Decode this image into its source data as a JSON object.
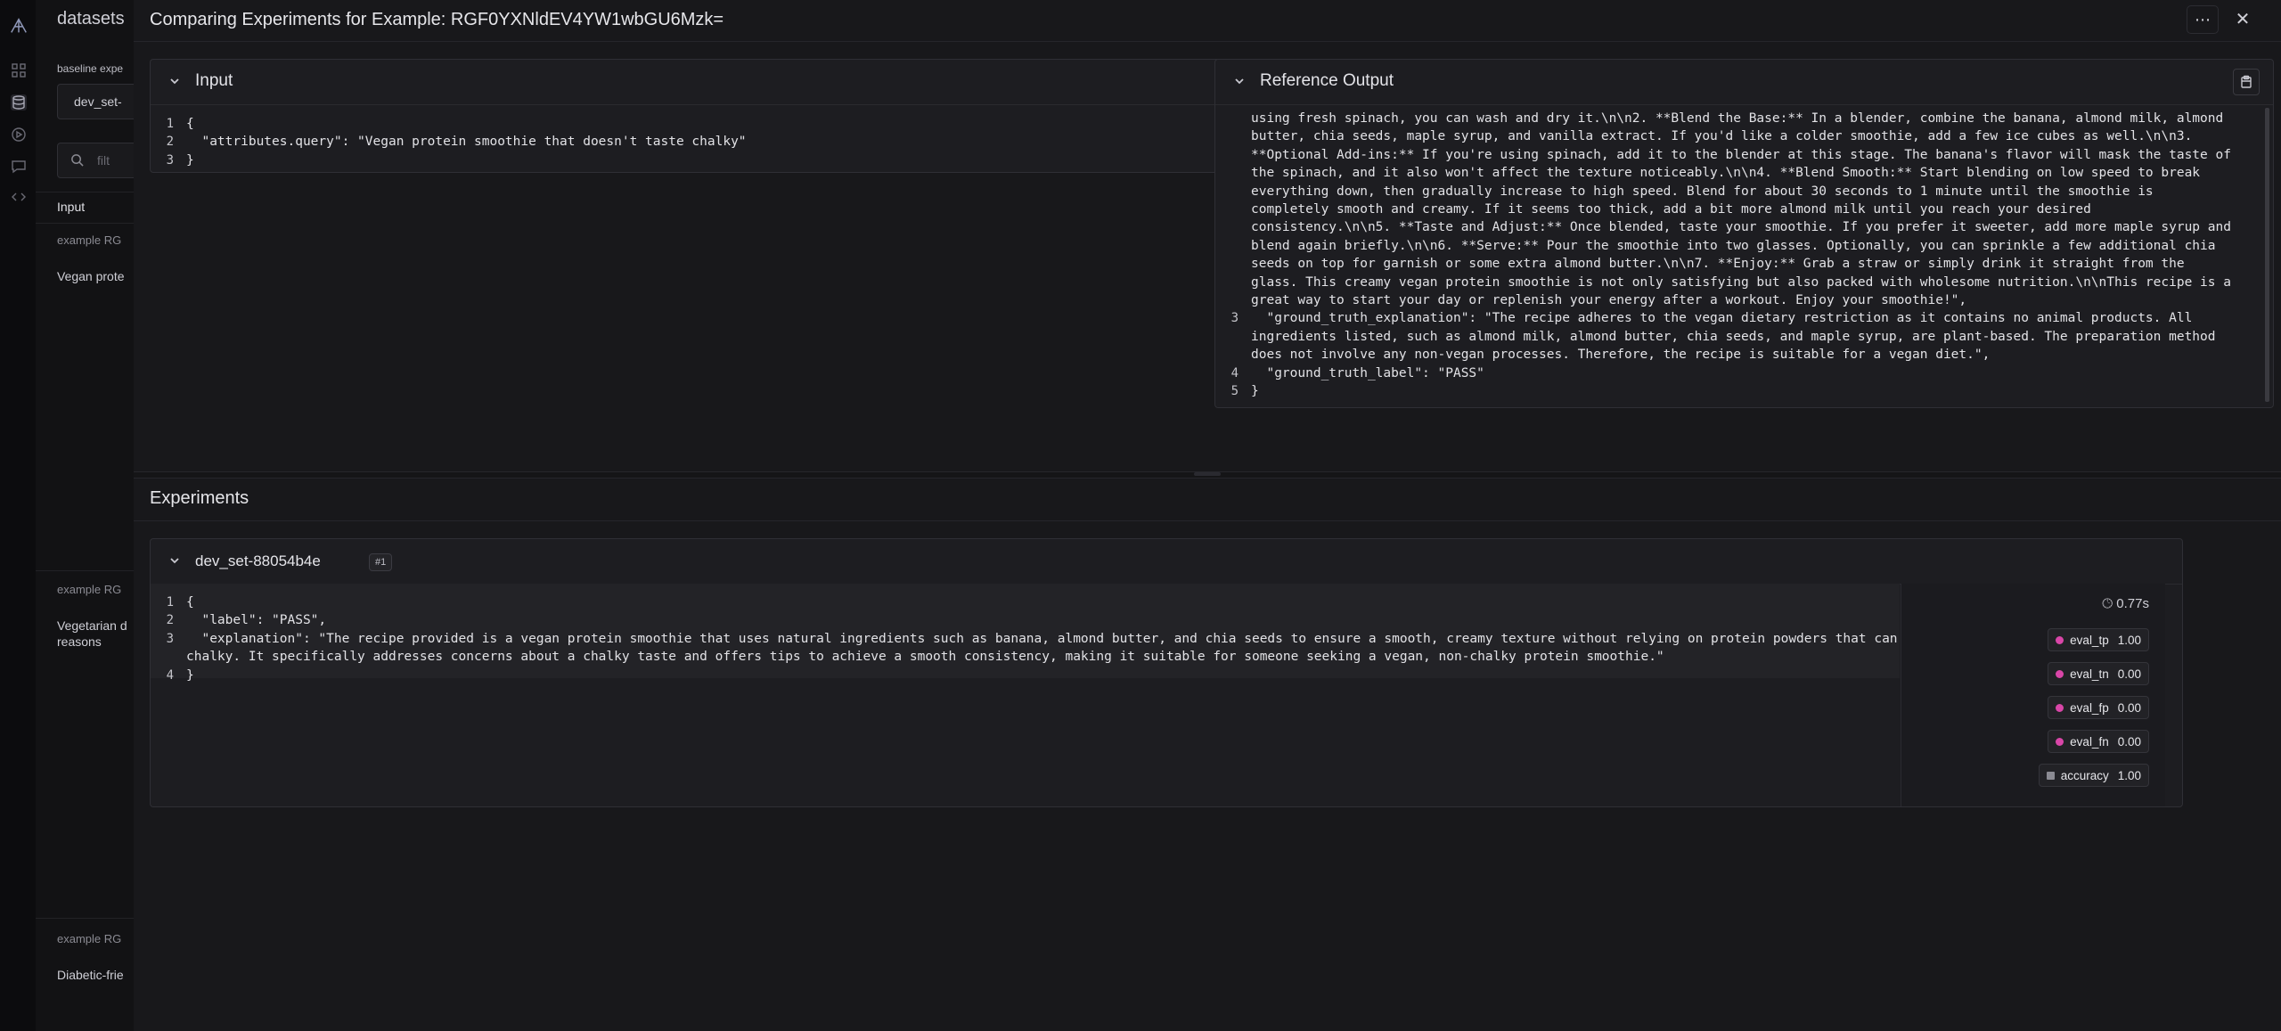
{
  "sidebar": {
    "section_title": "datasets",
    "baseline_label": "baseline expe",
    "select_value": "dev_set-",
    "filter_placeholder": "filt",
    "input_header": "Input",
    "rows": [
      {
        "example_label": "example RG",
        "text": "Vegan prote",
        "text2": ""
      },
      {
        "example_label": "example RG",
        "text": "Vegetarian d",
        "text2": "reasons"
      },
      {
        "example_label": "example RG",
        "text": "Diabetic-frie",
        "text2": ""
      }
    ]
  },
  "modal": {
    "title": "Comparing Experiments for Example: RGF0YXNldEV4YW1wbGU6Mzk=",
    "menu_icon": "ellipsis-icon",
    "close_icon": "close-icon"
  },
  "input_panel": {
    "title": "Input",
    "lines": [
      {
        "n": "1",
        "text": "{"
      },
      {
        "n": "2",
        "text": "  \"attributes.query\": \"Vegan protein smoothie that doesn't taste chalky\""
      },
      {
        "n": "3",
        "text": "}"
      }
    ]
  },
  "reference_panel": {
    "title": "Reference Output",
    "lines": [
      {
        "n": "",
        "text": "using fresh spinach, you can wash and dry it.\\n\\n2. **Blend the Base:** In a blender, combine the banana, almond milk, almond"
      },
      {
        "n": "",
        "text": "butter, chia seeds, maple syrup, and vanilla extract. If you'd like a colder smoothie, add a few ice cubes as well.\\n\\n3."
      },
      {
        "n": "",
        "text": "**Optional Add-ins:** If you're using spinach, add it to the blender at this stage. The banana's flavor will mask the taste of"
      },
      {
        "n": "",
        "text": "the spinach, and it also won't affect the texture noticeably.\\n\\n4. **Blend Smooth:** Start blending on low speed to break"
      },
      {
        "n": "",
        "text": "everything down, then gradually increase to high speed. Blend for about 30 seconds to 1 minute until the smoothie is"
      },
      {
        "n": "",
        "text": "completely smooth and creamy. If it seems too thick, add a bit more almond milk until you reach your desired"
      },
      {
        "n": "",
        "text": "consistency.\\n\\n5. **Taste and Adjust:** Once blended, taste your smoothie. If you prefer it sweeter, add more maple syrup and"
      },
      {
        "n": "",
        "text": "blend again briefly.\\n\\n6. **Serve:** Pour the smoothie into two glasses. Optionally, you can sprinkle a few additional chia"
      },
      {
        "n": "",
        "text": "seeds on top for garnish or some extra almond butter.\\n\\n7. **Enjoy:** Grab a straw or simply drink it straight from the"
      },
      {
        "n": "",
        "text": "glass. This creamy vegan protein smoothie is not only satisfying but also packed with wholesome nutrition.\\n\\nThis recipe is a"
      },
      {
        "n": "",
        "text": "great way to start your day or replenish your energy after a workout. Enjoy your smoothie!\","
      },
      {
        "n": "3",
        "text": "  \"ground_truth_explanation\": \"The recipe adheres to the vegan dietary restriction as it contains no animal products. All"
      },
      {
        "n": "",
        "text": "ingredients listed, such as almond milk, almond butter, chia seeds, and maple syrup, are plant-based. The preparation method"
      },
      {
        "n": "",
        "text": "does not involve any non-vegan processes. Therefore, the recipe is suitable for a vegan diet.\","
      },
      {
        "n": "4",
        "text": "  \"ground_truth_label\": \"PASS\""
      },
      {
        "n": "5",
        "text": "}"
      }
    ]
  },
  "experiments": {
    "title": "Experiments",
    "card": {
      "name": "dev_set-88054b4e",
      "badge": "#1",
      "lines": [
        {
          "n": "1",
          "text": "{"
        },
        {
          "n": "2",
          "text": "  \"label\": \"PASS\","
        },
        {
          "n": "3",
          "text": "  \"explanation\": \"The recipe provided is a vegan protein smoothie that uses natural ingredients such as banana, almond butter, and chia seeds to ensure a smooth, creamy texture without relying on protein powders that can taste"
        },
        {
          "n": "",
          "text": "chalky. It specifically addresses concerns about a chalky taste and offers tips to achieve a smooth consistency, making it suitable for someone seeking a vegan, non-chalky protein smoothie.\""
        },
        {
          "n": "4",
          "text": "}"
        }
      ],
      "latency": "0.77s",
      "metrics": [
        {
          "name": "eval_tp",
          "value": "1.00",
          "color": "#d946a8"
        },
        {
          "name": "eval_tn",
          "value": "0.00",
          "color": "#d946a8"
        },
        {
          "name": "eval_fp",
          "value": "0.00",
          "color": "#d946a8"
        },
        {
          "name": "eval_fn",
          "value": "0.00",
          "color": "#d946a8"
        },
        {
          "name": "accuracy",
          "value": "1.00",
          "color": "#8a8a92"
        }
      ]
    }
  }
}
